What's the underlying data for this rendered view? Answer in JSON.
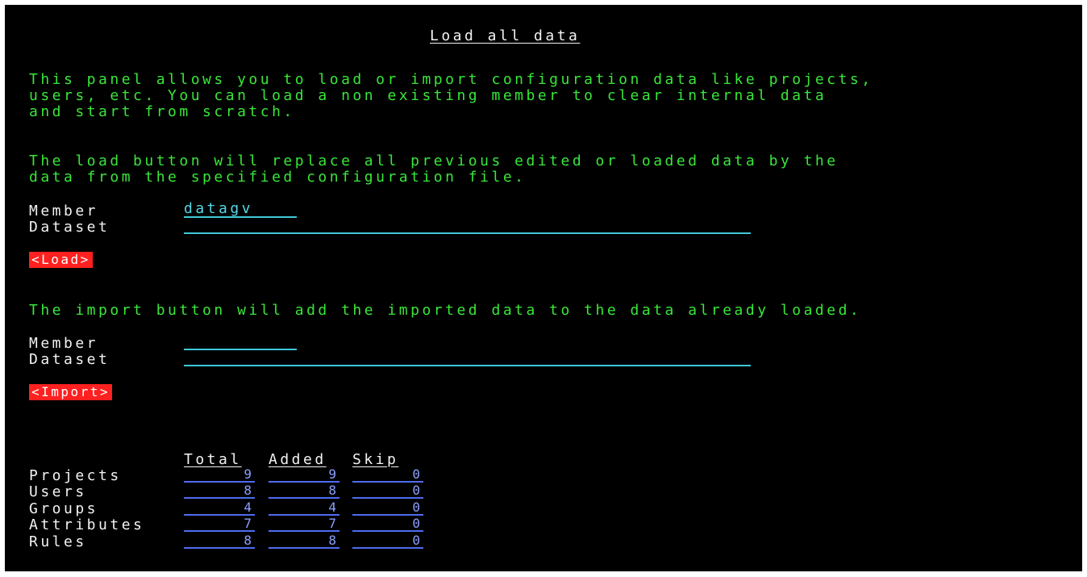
{
  "title": "Load all data",
  "intro": [
    "This panel allows you to load or import configuration data like projects,",
    "users, etc. You can load a non existing member to clear internal data",
    "and start from scratch."
  ],
  "load_section": {
    "description": [
      "The load button will replace all previous edited or loaded data by the",
      "data from the specified configuration file."
    ],
    "member_label": "Member",
    "member_value": "datagv",
    "dataset_label": "Dataset",
    "dataset_value": "",
    "button_label": "<Load>"
  },
  "import_section": {
    "description": "The import button will add the imported data to the data already loaded.",
    "member_label": "Member",
    "member_value": "",
    "dataset_label": "Dataset",
    "dataset_value": "",
    "button_label": "<Import>"
  },
  "stats": {
    "columns": [
      "Total",
      "Added",
      "Skip"
    ],
    "rows": [
      {
        "label": "Projects",
        "values": [
          "9",
          "9",
          "0"
        ]
      },
      {
        "label": "Users",
        "values": [
          "8",
          "8",
          "0"
        ]
      },
      {
        "label": "Groups",
        "values": [
          "4",
          "4",
          "0"
        ]
      },
      {
        "label": "Attributes",
        "values": [
          "7",
          "7",
          "0"
        ]
      },
      {
        "label": "Rules",
        "values": [
          "8",
          "8",
          "0"
        ]
      }
    ]
  },
  "colors": {
    "background": "#000000",
    "text_green": "#39e639",
    "text_white": "#f2f2f2",
    "input_cyan": "#3fc9d8",
    "button_red": "#ff2020",
    "output_blue": "#4f6cf0"
  }
}
